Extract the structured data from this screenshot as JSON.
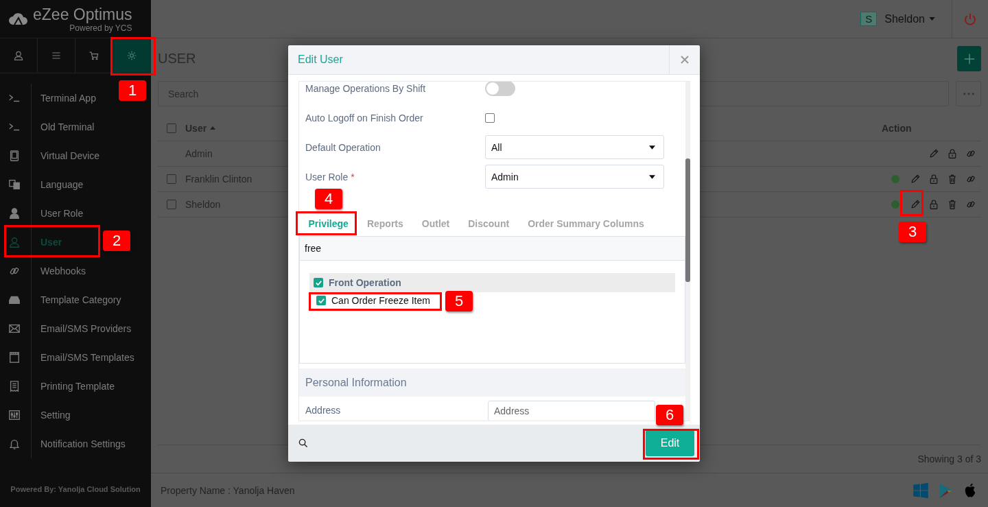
{
  "sidebar": {
    "logo": {
      "name": "eZee Optimus",
      "tagline": "Powered by YCS"
    },
    "tabs": [
      {
        "kind": "user",
        "selected": false
      },
      {
        "kind": "list",
        "selected": false
      },
      {
        "kind": "cart",
        "selected": false
      },
      {
        "kind": "gear",
        "selected": true
      }
    ],
    "menu": [
      {
        "label": "Terminal App",
        "kind": "prompt",
        "selected": false
      },
      {
        "label": "Old Terminal",
        "kind": "prompt",
        "selected": false
      },
      {
        "label": "Virtual Device",
        "kind": "tablet",
        "selected": false
      },
      {
        "label": "Language",
        "kind": "language",
        "selected": false
      },
      {
        "label": "User Role",
        "kind": "person",
        "selected": false
      },
      {
        "label": "User",
        "kind": "person-outline",
        "selected": true
      },
      {
        "label": "Webhooks",
        "kind": "link",
        "selected": false
      },
      {
        "label": "Template Category",
        "kind": "tray",
        "selected": false
      },
      {
        "label": "Email/SMS Providers",
        "kind": "envelope",
        "selected": false
      },
      {
        "label": "Email/SMS Templates",
        "kind": "film",
        "selected": false
      },
      {
        "label": "Printing Template",
        "kind": "receipt",
        "selected": false
      },
      {
        "label": "Setting",
        "kind": "sliders",
        "selected": false
      },
      {
        "label": "Notification Settings",
        "kind": "bell",
        "selected": false
      }
    ],
    "footer": "Powered By: Yanolja Cloud Solution"
  },
  "header": {
    "user_initial": "S",
    "user_name": "Sheldon"
  },
  "page": {
    "title": "USER",
    "search": {
      "placeholder": "Search"
    },
    "table": {
      "select_all": {
        "checked": false
      },
      "columns": [
        {
          "label": "User",
          "sorted": true
        },
        {
          "label": "Action"
        }
      ],
      "rows": [
        {
          "user": "Admin",
          "actions": [
            {
              "kind": "edit"
            },
            {
              "kind": "lock"
            },
            {
              "kind": "link"
            }
          ]
        },
        {
          "user": "Franklin Clinton",
          "checked": false,
          "active": true,
          "actions": [
            {
              "kind": "edit"
            },
            {
              "kind": "lock"
            },
            {
              "kind": "delete"
            },
            {
              "kind": "link"
            }
          ]
        },
        {
          "user": "Sheldon",
          "checked": false,
          "active": true,
          "actions": [
            {
              "kind": "edit"
            },
            {
              "kind": "lock"
            },
            {
              "kind": "delete"
            },
            {
              "kind": "link"
            }
          ]
        }
      ]
    },
    "showing": "Showing 3 of 3"
  },
  "footer": {
    "property": "Property Name : Yanolja Haven"
  },
  "dialog": {
    "title": "Edit User",
    "fields": [
      {
        "kind": "toggle",
        "label": "Manage Operations By Shift",
        "on": false
      },
      {
        "kind": "checkbox",
        "label": "Auto Logoff on Finish Order",
        "checked": false
      },
      {
        "kind": "select",
        "label": "Default Operation",
        "value": "All"
      },
      {
        "kind": "select",
        "label": "User Role",
        "value": "Admin",
        "required_mark": "*"
      }
    ],
    "tabs": [
      {
        "label": "Privilege",
        "selected": true
      },
      {
        "label": "Reports",
        "selected": false
      },
      {
        "label": "Outlet",
        "selected": false
      },
      {
        "label": "Discount",
        "selected": false
      },
      {
        "label": "Order Summary Columns",
        "selected": false
      }
    ],
    "filter": {
      "value": "free"
    },
    "privileges": [
      {
        "label": "Front Operation",
        "checked": true,
        "children": [
          {
            "label": "Can Order Freeze Item",
            "checked": true
          }
        ]
      }
    ],
    "section": "Personal Information",
    "address": {
      "label": "Address",
      "placeholder": "Address"
    },
    "button": "Edit"
  },
  "callouts": [
    {
      "number": "1"
    },
    {
      "number": "2"
    },
    {
      "number": "3"
    },
    {
      "number": "4"
    },
    {
      "number": "5"
    },
    {
      "number": "6"
    }
  ]
}
